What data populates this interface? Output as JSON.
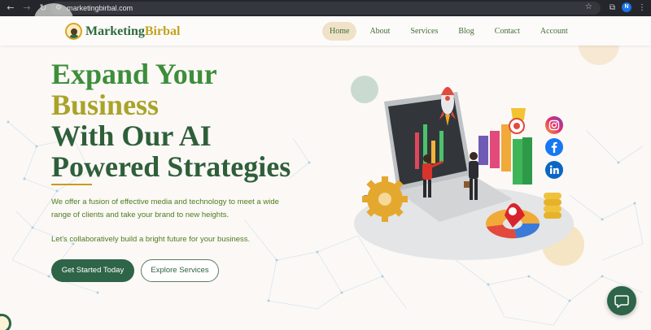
{
  "browser": {
    "url": "marketingbirbal.com",
    "profile_initial": "N"
  },
  "brand": {
    "name_part1": "Marketing",
    "name_part2": "Birbal"
  },
  "nav": {
    "items": [
      {
        "label": "Home",
        "active": true
      },
      {
        "label": "About",
        "active": false
      },
      {
        "label": "Services",
        "active": false
      },
      {
        "label": "Blog",
        "active": false
      },
      {
        "label": "Contact",
        "active": false
      },
      {
        "label": "Account",
        "active": false
      }
    ]
  },
  "hero": {
    "headline_line1": "Expand Your",
    "headline_line2": "Business",
    "headline_line3": "With Our AI",
    "headline_line4": "Powered Strategies",
    "description": "We offer a fusion of effective media and technology to meet a wide range of clients and take your brand to new heights.",
    "tagline": "Let's collaboratively build a bright future for your business.",
    "primary_button": "Get Started Today",
    "secondary_button": "Explore Services"
  },
  "colors": {
    "primary_green": "#2e6447",
    "accent_gold": "#c0a31d",
    "headline_green": "#3d8e3a"
  },
  "icons": [
    "instagram-icon",
    "facebook-icon",
    "linkedin-icon",
    "chat-icon"
  ]
}
